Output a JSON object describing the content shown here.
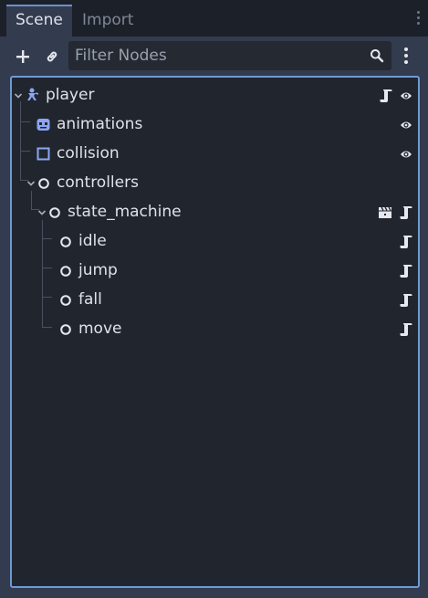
{
  "tabs": [
    {
      "label": "Scene",
      "active": true
    },
    {
      "label": "Import",
      "active": false
    }
  ],
  "toolbar": {
    "add_icon": "plus-icon",
    "link_icon": "link-icon",
    "filter_placeholder": "Filter Nodes",
    "filter_value": "",
    "search_icon": "search-icon",
    "menu_icon": "kebab-menu-icon"
  },
  "tree": {
    "nodes": [
      {
        "label": "player",
        "icon": "character-node-icon",
        "expanded": true,
        "depth": 0,
        "right_icons": [
          "script-icon",
          "visibility-eye-icon"
        ]
      },
      {
        "label": "animations",
        "icon": "animated-sprite-icon",
        "depth": 1,
        "right_icons": [
          "visibility-eye-icon"
        ]
      },
      {
        "label": "collision",
        "icon": "collision-shape-icon",
        "depth": 1,
        "right_icons": [
          "visibility-eye-icon"
        ]
      },
      {
        "label": "controllers",
        "icon": "node-circle-icon",
        "expanded": true,
        "depth": 1,
        "right_icons": []
      },
      {
        "label": "state_machine",
        "icon": "node-circle-icon",
        "expanded": true,
        "depth": 2,
        "right_icons": [
          "clapperboard-icon",
          "script-icon"
        ]
      },
      {
        "label": "idle",
        "icon": "node-circle-icon",
        "depth": 3,
        "right_icons": [
          "script-icon"
        ]
      },
      {
        "label": "jump",
        "icon": "node-circle-icon",
        "depth": 3,
        "right_icons": [
          "script-icon"
        ]
      },
      {
        "label": "fall",
        "icon": "node-circle-icon",
        "depth": 3,
        "right_icons": [
          "script-icon"
        ]
      },
      {
        "label": "move",
        "icon": "node-circle-icon",
        "depth": 3,
        "right_icons": [
          "script-icon"
        ]
      }
    ]
  },
  "colors": {
    "accent": "#6e9ad3",
    "panel": "#333b4f",
    "tree_bg": "#21262e",
    "text": "#dfe2e8",
    "node_icon_blue": "#8da5f3"
  }
}
